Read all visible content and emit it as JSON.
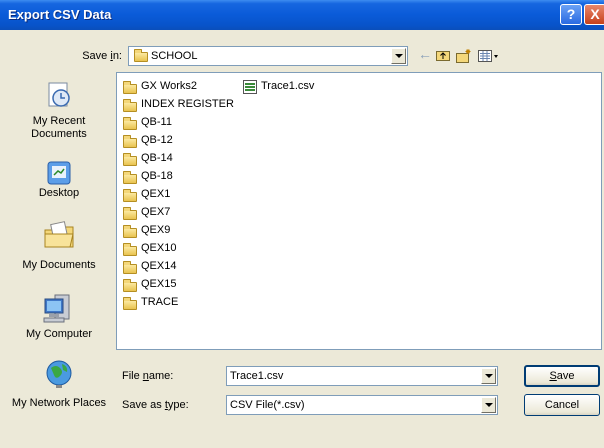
{
  "window": {
    "title": "Export CSV Data",
    "help_label": "?",
    "close_label": "X"
  },
  "save_in": {
    "label_prefix": "Save ",
    "label_mnemonic": "i",
    "label_suffix": "n:",
    "value": "SCHOOL"
  },
  "places": [
    {
      "name": "My Recent Documents",
      "icon": "recent-documents-icon"
    },
    {
      "name": "Desktop",
      "icon": "desktop-icon"
    },
    {
      "name": "My Documents",
      "icon": "my-documents-icon"
    },
    {
      "name": "My Computer",
      "icon": "my-computer-icon"
    },
    {
      "name": "My Network Places",
      "icon": "network-places-icon"
    }
  ],
  "files": {
    "folders": [
      "GX Works2",
      "INDEX REGISTER",
      "QB-11",
      "QB-12",
      "QB-14",
      "QB-18",
      "QEX1",
      "QEX7",
      "QEX9",
      "QEX10",
      "QEX14",
      "QEX15",
      "TRACE"
    ],
    "csv_files": [
      "Trace1.csv"
    ]
  },
  "file_name": {
    "label_prefix": "File ",
    "label_mnemonic": "n",
    "label_suffix": "ame:",
    "value": "Trace1.csv"
  },
  "save_as_type": {
    "label_prefix": "Save as ",
    "label_mnemonic": "t",
    "label_suffix": "ype:",
    "value": "CSV File(*.csv)"
  },
  "buttons": {
    "save_mnemonic": "S",
    "save_rest": "ave",
    "cancel": "Cancel"
  },
  "colors": {
    "titlebar": "#0a5bd8",
    "dialog_bg": "#ece9d8",
    "field_border": "#7f9db9"
  }
}
